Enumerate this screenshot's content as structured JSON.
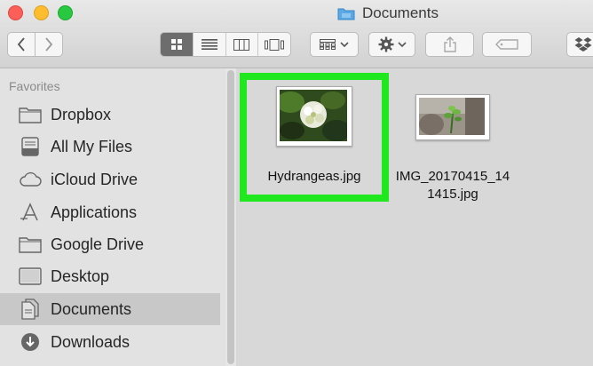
{
  "window": {
    "title": "Documents"
  },
  "sidebar": {
    "heading": "Favorites",
    "items": [
      {
        "label": "Dropbox",
        "icon": "folder-icon"
      },
      {
        "label": "All My Files",
        "icon": "all-files-icon"
      },
      {
        "label": "iCloud Drive",
        "icon": "cloud-icon"
      },
      {
        "label": "Applications",
        "icon": "applications-icon"
      },
      {
        "label": "Google Drive",
        "icon": "folder-icon"
      },
      {
        "label": "Desktop",
        "icon": "desktop-icon"
      },
      {
        "label": "Documents",
        "icon": "documents-icon",
        "selected": true
      },
      {
        "label": "Downloads",
        "icon": "downloads-icon"
      }
    ]
  },
  "files": [
    {
      "name": "Hydrangeas.jpg",
      "selected": true
    },
    {
      "name_line1": "IMG_20170415_14",
      "name_line2": "1415.jpg"
    }
  ],
  "colors": {
    "highlight": "#20e81f",
    "sidebar_selected": "#c8c8c8"
  }
}
